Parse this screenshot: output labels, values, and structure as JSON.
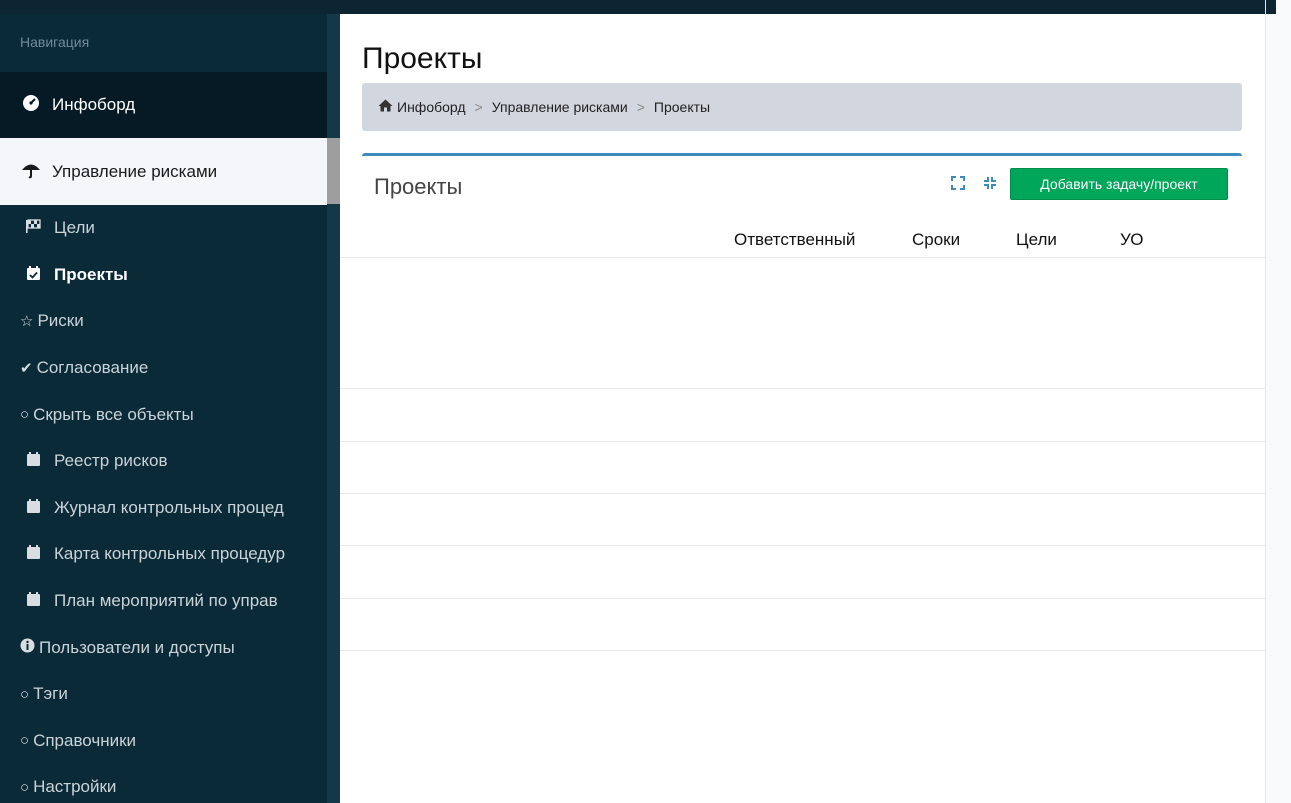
{
  "sidebar": {
    "header": "Навигация",
    "top_item": {
      "label": "Инфоборд",
      "icon": "dashboard-icon"
    },
    "active_section": {
      "label": "Управление рисками",
      "icon": "umbrella-icon"
    },
    "items": [
      {
        "label": "Цели",
        "icon": "flag-checkered-icon"
      },
      {
        "label": "Проекты",
        "icon": "calendar-check-icon"
      },
      {
        "label": "Риски",
        "icon": "star-outline-icon"
      },
      {
        "label": "Согласование",
        "icon": "check-icon"
      },
      {
        "label": "Скрыть все объекты",
        "icon": "circle-outline-icon"
      },
      {
        "label": "Реестр рисков",
        "icon": "calendar-icon"
      },
      {
        "label": "Журнал контрольных процед",
        "icon": "calendar-icon"
      },
      {
        "label": "Карта контрольных процедур",
        "icon": "calendar-icon"
      },
      {
        "label": "План мероприятий по управ",
        "icon": "calendar-icon"
      },
      {
        "label": "Пользователи и доступы",
        "icon": "info-circle-icon"
      },
      {
        "label": "Тэги",
        "icon": "circle-outline-icon"
      },
      {
        "label": "Справочники",
        "icon": "circle-outline-icon"
      },
      {
        "label": "Настройки",
        "icon": "circle-outline-icon"
      }
    ]
  },
  "main": {
    "page_title": "Проекты",
    "breadcrumb": [
      "Инфоборд",
      "Управление рисками",
      "Проекты"
    ],
    "breadcrumb_separator": ">",
    "card": {
      "title": "Проекты",
      "add_button": "Добавить задачу/проект",
      "columns": [
        "Ответственный",
        "Сроки",
        "Цели",
        "УО"
      ]
    }
  },
  "colors": {
    "sidebar_bg": "#0b2a38",
    "accent": "#3c8dbc",
    "add_button": "#00a65a"
  }
}
